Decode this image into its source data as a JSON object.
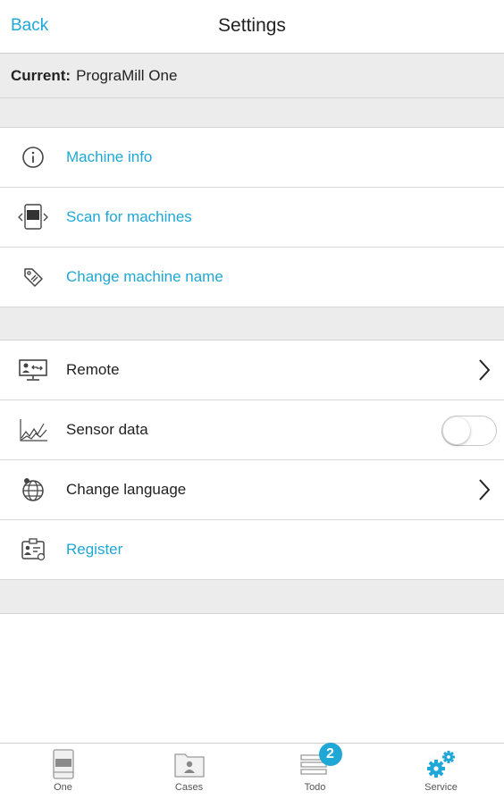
{
  "nav": {
    "back_label": "Back",
    "title": "Settings"
  },
  "current": {
    "label": "Current:",
    "machine": "PrograMill One"
  },
  "section1": [
    {
      "label": "Machine info",
      "icon": "info-icon"
    },
    {
      "label": "Scan for machines",
      "icon": "scan-machines-icon"
    },
    {
      "label": "Change machine name",
      "icon": "tag-icon"
    }
  ],
  "section2": [
    {
      "label": "Remote",
      "icon": "remote-desktop-icon",
      "accessory": "chevron"
    },
    {
      "label": "Sensor data",
      "icon": "sensor-chart-icon",
      "accessory": "toggle",
      "enabled": false
    },
    {
      "label": "Change language",
      "icon": "globe-icon",
      "accessory": "chevron"
    },
    {
      "label": "Register",
      "icon": "register-id-card-icon"
    }
  ],
  "tabs": [
    {
      "label": "One",
      "icon": "machine-icon",
      "active": false
    },
    {
      "label": "Cases",
      "icon": "cases-folder-icon",
      "active": false
    },
    {
      "label": "Todo",
      "icon": "todo-stack-icon",
      "badge": "2",
      "active": false
    },
    {
      "label": "Service",
      "icon": "gears-icon",
      "active": true
    }
  ],
  "colors": {
    "accent": "#1fa7d6",
    "section_bg": "#ececec",
    "text": "#222222"
  }
}
